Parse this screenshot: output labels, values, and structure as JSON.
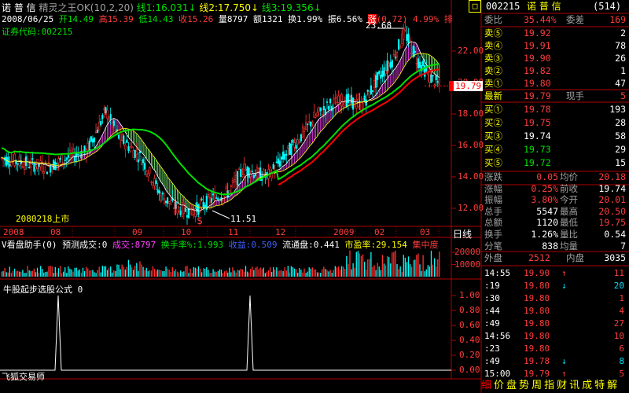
{
  "header": {
    "stock_name": "诺 普 信",
    "indicator": "精灵之王OK(10,2,20)",
    "line1": "线1:16.031",
    "line2": "线2:17.750",
    "line3": "线3:19.356",
    "arrow": "↓",
    "date": "2008/06/25",
    "open": "开14.49",
    "high": "高15.39",
    "low": "低14.43",
    "close": "收15.26",
    "volume": "量8797",
    "amount": "额1321",
    "turnover": "换1.99%",
    "amplitude": "振6.56%",
    "change_label": "涨",
    "change_value": "(0.72)",
    "change_pct": "4.99%",
    "change_tail": "排",
    "code_label": "证券代码:002215",
    "corner_btn": "□"
  },
  "price_axis": [
    "22.00",
    "20.00",
    "18.00",
    "16.00",
    "14.00",
    "12.00"
  ],
  "price_tag": "19.79",
  "annotations": {
    "high_label": "23.68",
    "low_label": "11.51",
    "listing": "2080218上市",
    "s_marker": "$"
  },
  "time_axis": [
    "2008",
    "08",
    "09",
    "10",
    "11",
    "12",
    "2009",
    "02",
    "03"
  ],
  "period_label": "日线",
  "vol_header": {
    "title": "V看盘助手(0)",
    "forecast": "预测成交:0",
    "vol": "成交:8797",
    "turn": "换手率%:1.993",
    "yield": "收益:0.509",
    "float": "流通盘:0.441",
    "pe": "市盈率:29.154",
    "conc": "集中度"
  },
  "vol_axis": [
    "20000",
    "10000"
  ],
  "ind_title": "牛股起步选股公式 0",
  "ind_axis": [
    "1.00",
    "0.80",
    "0.60",
    "0.40",
    "0.20",
    "0.00"
  ],
  "ind_footer": "飞狐交易师",
  "quote": {
    "code": "002215",
    "name": "诺 普 信",
    "count": "(514)",
    "weibi_label": "委比",
    "weibi_val": "35.44%",
    "weicha_label": "委差",
    "weicha_val": "169",
    "asks": [
      {
        "label": "卖⑤",
        "price": "19.92",
        "vol": "2"
      },
      {
        "label": "卖④",
        "price": "19.91",
        "vol": "78"
      },
      {
        "label": "卖③",
        "price": "19.90",
        "vol": "26"
      },
      {
        "label": "卖②",
        "price": "19.82",
        "vol": "1"
      },
      {
        "label": "卖①",
        "price": "19.80",
        "vol": "47"
      }
    ],
    "latest_label": "最新",
    "latest_val": "19.79",
    "xianshou_label": "现手",
    "xianshou_val": "5",
    "bids": [
      {
        "label": "买①",
        "price": "19.78",
        "vol": "193"
      },
      {
        "label": "买②",
        "price": "19.75",
        "vol": "28"
      },
      {
        "label": "买③",
        "price": "19.74",
        "vol": "58"
      },
      {
        "label": "买④",
        "price": "19.73",
        "vol": "29"
      },
      {
        "label": "买⑤",
        "price": "19.72",
        "vol": "15"
      }
    ],
    "stats": [
      {
        "l1": "涨跌",
        "v1": "0.05",
        "l2": "均价",
        "v2": "20.18"
      },
      {
        "l1": "涨幅",
        "v1": "0.25%",
        "l2": "前收",
        "v2": "19.74"
      },
      {
        "l1": "振幅",
        "v1": "3.80%",
        "l2": "今开",
        "v2": "20.01"
      },
      {
        "l1": "总手",
        "v1": "5547",
        "l2": "最高",
        "v2": "20.50"
      },
      {
        "l1": "总额",
        "v1": "1120",
        "l2": "最低",
        "v2": "19.75"
      },
      {
        "l1": "换手",
        "v1": "1.26%",
        "l2": "量比",
        "v2": "0.54"
      },
      {
        "l1": "分笔",
        "v1": "838",
        "l2": "均量",
        "v2": "7"
      }
    ],
    "waipan_label": "外盘",
    "waipan_val": "2512",
    "neipan_label": "内盘",
    "neipan_val": "3035"
  },
  "ticks": [
    {
      "t": "14:55",
      "p": "19.90",
      "a": "↑",
      "v": "11"
    },
    {
      "t": ":19",
      "p": "19.80",
      "a": "↓",
      "v": "20"
    },
    {
      "t": ":30",
      "p": "19.80",
      "a": "",
      "v": "1"
    },
    {
      "t": ":44",
      "p": "19.80",
      "a": "",
      "v": "4"
    },
    {
      "t": ":49",
      "p": "19.80",
      "a": "",
      "v": "27"
    },
    {
      "t": "14:56",
      "p": "19.80",
      "a": "",
      "v": "10"
    },
    {
      "t": ":23",
      "p": "19.80",
      "a": "",
      "v": "6"
    },
    {
      "t": ":49",
      "p": "19.78",
      "a": "↓",
      "v": "8"
    },
    {
      "t": "15:00",
      "p": "19.79",
      "a": "↑",
      "v": "5"
    }
  ],
  "bottom_tabs": [
    "细",
    "价",
    "盘",
    "势",
    "周",
    "指",
    "财",
    "讯",
    "成",
    "特",
    "解"
  ],
  "chart_data": {
    "type": "candlestick",
    "title": "",
    "xlabel": "",
    "ylabel": "",
    "x": [
      "2008",
      "08",
      "09",
      "10",
      "11",
      "12",
      "2009",
      "02",
      "03"
    ],
    "ylim": [
      11,
      24
    ],
    "high_marker": 23.68,
    "low_marker": 11.51,
    "last_price": 19.79,
    "indicator_signal_x": [
      "2008/06",
      "2008/12"
    ],
    "indicator_ylim": [
      0,
      1
    ]
  }
}
